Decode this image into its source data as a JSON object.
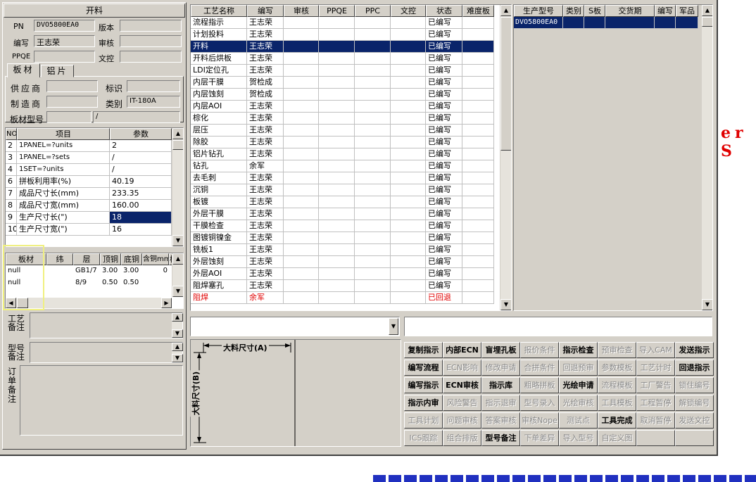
{
  "panel_title": "开料",
  "header": {
    "pn_label": "PN",
    "pn_value": "DVO5800EA0",
    "version_label": "版本",
    "version_value": "",
    "author_label": "编写",
    "author_value": "王志荣",
    "review_label": "审核",
    "review_value": "",
    "ppqe_label": "PPQE",
    "ppqe_value": "",
    "doc_label": "文控",
    "doc_value": ""
  },
  "tabs": [
    {
      "label": "板材"
    },
    {
      "label": "铝片"
    }
  ],
  "material": {
    "supplier_label": "供应商",
    "supplier_value": "",
    "mark_label": "标识",
    "mark_value": "",
    "maker_label": "制造商",
    "maker_value": "",
    "category_label": "类别",
    "category_value": "IT-180A",
    "model_label": "板材型号",
    "model_value": "",
    "model_extra": "/"
  },
  "param_table": {
    "headers": [
      "NO",
      "项目",
      "参数"
    ],
    "rows": [
      [
        "2",
        "1PANEL=?units",
        "2"
      ],
      [
        "3",
        "1PANEL=?sets",
        "/"
      ],
      [
        "4",
        "1SET=?units",
        "/"
      ],
      [
        "6",
        "拼板利用率(%)",
        "40.19"
      ],
      [
        "7",
        "成品尺寸长(mm)",
        "233.35"
      ],
      [
        "8",
        "成品尺寸宽(mm)",
        "160.00"
      ],
      [
        "9",
        "生产尺寸长(\")",
        "18"
      ],
      [
        "10",
        "生产尺寸宽(\")",
        "16"
      ]
    ]
  },
  "board_table": {
    "headers": [
      "板材",
      "纬",
      "层",
      "顶铜",
      "底铜",
      "含铜mm",
      "板"
    ],
    "rows": [
      [
        "null",
        "",
        "GB1/7",
        "3.00",
        "3.00",
        "0"
      ],
      [
        "null",
        "",
        "8/9",
        "0.50",
        "0.50",
        ""
      ]
    ]
  },
  "notes": {
    "process_note_label": "工艺备注",
    "model_note_label": "型号备注",
    "order_note_label": "订单备注"
  },
  "process_table": {
    "headers": [
      "工艺名称",
      "编写",
      "审核",
      "PPQE",
      "PPC",
      "文控",
      "状态",
      "难度板"
    ],
    "rows": [
      {
        "name": "流程指示",
        "author": "王志荣",
        "status": "已编写"
      },
      {
        "name": "计划投料",
        "author": "王志荣",
        "status": "已编写"
      },
      {
        "name": "开料",
        "author": "王志荣",
        "status": "已编写"
      },
      {
        "name": "开料后烘板",
        "author": "王志荣",
        "status": "已编写"
      },
      {
        "name": "LDI定位孔",
        "author": "王志荣",
        "status": "已编写"
      },
      {
        "name": "内层干膜",
        "author": "贺检成",
        "status": "已编写"
      },
      {
        "name": "内层蚀刻",
        "author": "贺检成",
        "status": "已编写"
      },
      {
        "name": "内层AOI",
        "author": "王志荣",
        "status": "已编写"
      },
      {
        "name": "棕化",
        "author": "王志荣",
        "status": "已编写"
      },
      {
        "name": "层压",
        "author": "王志荣",
        "status": "已编写"
      },
      {
        "name": "除胶",
        "author": "王志荣",
        "status": "已编写"
      },
      {
        "name": "铝片钻孔",
        "author": "王志荣",
        "status": "已编写"
      },
      {
        "name": "钻孔",
        "author": "余军",
        "status": "已编写"
      },
      {
        "name": "去毛刺",
        "author": "王志荣",
        "status": "已编写"
      },
      {
        "name": "沉铜",
        "author": "王志荣",
        "status": "已编写"
      },
      {
        "name": "板镀",
        "author": "王志荣",
        "status": "已编写"
      },
      {
        "name": "外层干膜",
        "author": "王志荣",
        "status": "已编写"
      },
      {
        "name": "干膜检查",
        "author": "王志荣",
        "status": "已编写"
      },
      {
        "name": "图镀铜镍金",
        "author": "王志荣",
        "status": "已编写"
      },
      {
        "name": "铣板1",
        "author": "王志荣",
        "status": "已编写"
      },
      {
        "name": "外层蚀刻",
        "author": "王志荣",
        "status": "已编写"
      },
      {
        "name": "外层AOI",
        "author": "王志荣",
        "status": "已编写"
      },
      {
        "name": "阻焊塞孔",
        "author": "王志荣",
        "status": "已编写"
      },
      {
        "name": "阻焊",
        "author": "余军",
        "status": "已回退"
      }
    ]
  },
  "model_table": {
    "headers": [
      "生产型号",
      "类别",
      "S板",
      "交货期",
      "编写",
      "军品"
    ],
    "rows": [
      [
        "DVO5800EA0",
        "",
        "",
        "",
        "",
        ""
      ]
    ]
  },
  "drawing": {
    "dim_a_label": "大料尺寸(A)",
    "dim_b_label": "大料尺寸(B)"
  },
  "buttons": [
    [
      "复制指示",
      "内部ECN",
      "盲埋孔板",
      "报价条件",
      "指示检查",
      "预审检查",
      "导入CAM",
      "发送指示"
    ],
    [
      "编写流程",
      "ECN影响",
      "修改申请",
      "合拼条件",
      "回退预审",
      "参数模板",
      "工艺计时",
      "回退指示"
    ],
    [
      "编写指示",
      "ECN审核",
      "指示库",
      "粗略拼板",
      "光绘申请",
      "流程模板",
      "工厂警告",
      "锁住编号"
    ],
    [
      "指示内审",
      "风险警告",
      "指示退审",
      "型号录入",
      "光绘审核",
      "工具模板",
      "工程暂停",
      "解锁编号"
    ],
    [
      "工具计划",
      "问题审核",
      "答案审核",
      "审核Nope",
      "测试点",
      "工具完成",
      "取消暂停",
      "发送文控"
    ],
    [
      "ICS跟踪",
      "组合排版",
      "型号备注",
      "下单差异",
      "导入型号",
      "自定义图",
      "",
      ""
    ]
  ],
  "bg_text": {
    "red_fragment": "er S"
  }
}
